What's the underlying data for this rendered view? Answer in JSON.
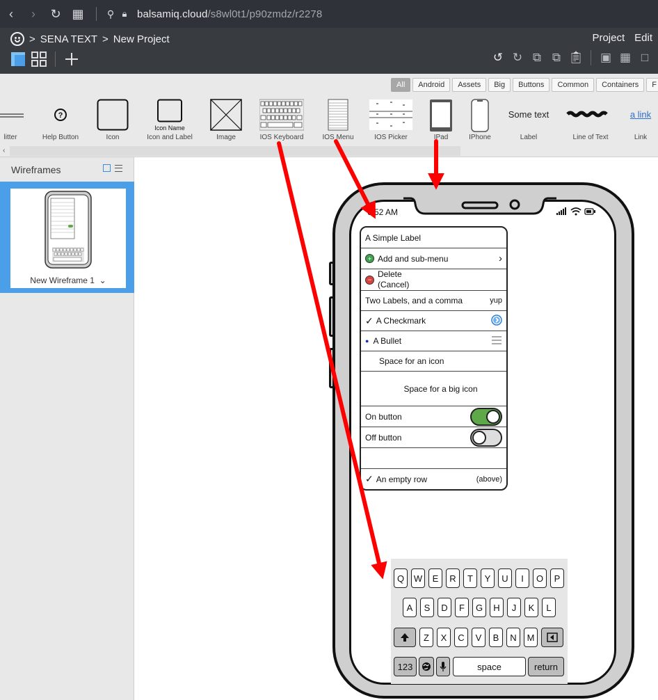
{
  "browser": {
    "url_host": "balsamiq.cloud",
    "url_path": "/s8wl0t1/p90zmdz/r2278"
  },
  "header": {
    "breadcrumb": [
      "SENA TEXT",
      "New Project"
    ],
    "separator": ">",
    "menu": [
      "Project",
      "Edit"
    ]
  },
  "library": {
    "filters": [
      "All",
      "Android",
      "Assets",
      "Big",
      "Buttons",
      "Common",
      "Containers",
      "F"
    ],
    "components": [
      {
        "label": "litter"
      },
      {
        "label": "Help Button",
        "glyph": "?"
      },
      {
        "label": "Icon"
      },
      {
        "label": "Icon and Label",
        "inner": "Icon Name"
      },
      {
        "label": "Image"
      },
      {
        "label": "IOS Keyboard"
      },
      {
        "label": "IOS Menu"
      },
      {
        "label": "IOS Picker"
      },
      {
        "label": "IPad"
      },
      {
        "label": "IPhone"
      },
      {
        "label": "Label",
        "inner": "Some text"
      },
      {
        "label": "Line of Text"
      },
      {
        "label": "Link",
        "inner": "a link"
      }
    ]
  },
  "sidebar": {
    "title": "Wireframes",
    "wireframe_name": "New Wireframe 1"
  },
  "phone": {
    "time": "6:52 AM"
  },
  "ios_menu": {
    "rows": [
      {
        "label": "A Simple Label"
      },
      {
        "label": "Add and sub-menu",
        "right": "›"
      },
      {
        "label": "Delete",
        "label2": "(Cancel)"
      },
      {
        "label": "Two Labels, and a comma",
        "right": "yup"
      },
      {
        "label": "A Checkmark",
        "prefix": "✓"
      },
      {
        "label": "A Bullet",
        "prefix": "●"
      },
      {
        "label": "Space for an icon"
      },
      {
        "label": "Space for a big icon"
      },
      {
        "label": "On button"
      },
      {
        "label": "Off button"
      },
      {
        "label": ""
      },
      {
        "label": "An empty row",
        "prefix": "✓",
        "right": "(above)"
      }
    ],
    "on_color": "#5fa84a"
  },
  "keyboard": {
    "row1": [
      "Q",
      "W",
      "E",
      "R",
      "T",
      "Y",
      "U",
      "I",
      "O",
      "P"
    ],
    "row2": [
      "A",
      "S",
      "D",
      "F",
      "G",
      "H",
      "J",
      "K",
      "L"
    ],
    "row3": [
      "Z",
      "X",
      "C",
      "V",
      "B",
      "N",
      "M"
    ],
    "num": "123",
    "space": "space",
    "return": "return"
  },
  "annotation_color": "#ff0000",
  "selection_color": "#4a9fe8"
}
